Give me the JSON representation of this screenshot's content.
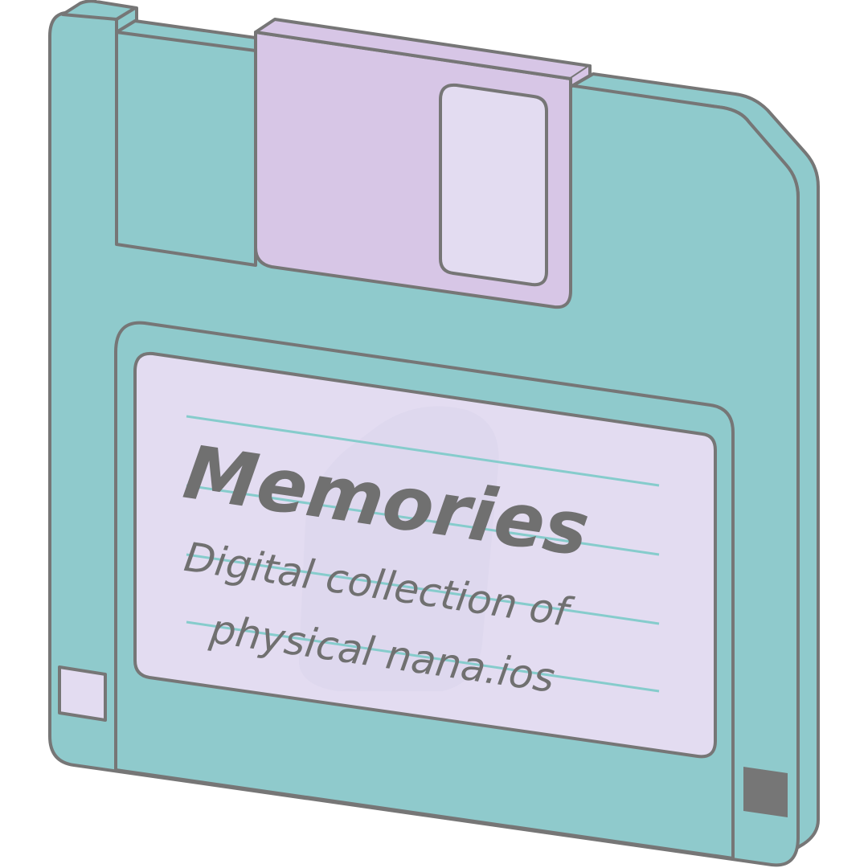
{
  "label": {
    "title": "Memories",
    "line1": "Digital collection of",
    "line2": "physical nana.ios"
  },
  "colors": {
    "body": "#8fcacc",
    "shutter": "#d7c6e6",
    "label_bg": "#e3dcf1",
    "outline": "#767676",
    "ruled_line": "#86cccc"
  }
}
